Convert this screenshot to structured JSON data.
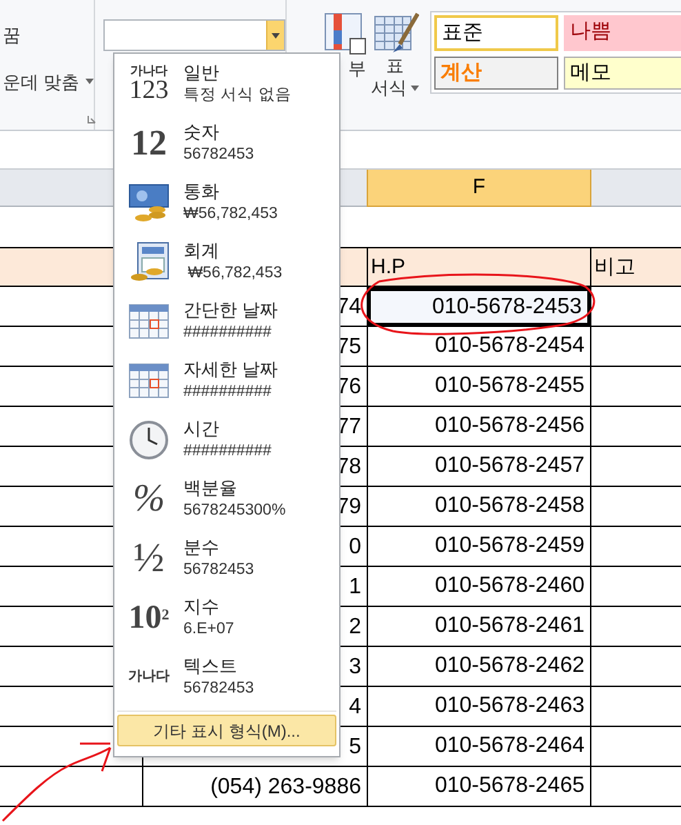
{
  "ribbon": {
    "wrap_text": "꿈",
    "merge_center": "운데 맞춤",
    "number_format": {
      "open": true
    },
    "conditional_format": "부",
    "table_format": [
      "표",
      "서식"
    ],
    "cell_styles": [
      {
        "label": "표준",
        "kind": "normal"
      },
      {
        "label": "나쁨",
        "kind": "bad"
      },
      {
        "label": "계산",
        "kind": "calculation"
      },
      {
        "label": "메모",
        "kind": "note"
      }
    ]
  },
  "format_menu": {
    "items": [
      {
        "name": "일반",
        "sample": "특정 서식 없음",
        "kind": "general",
        "glyphs": [
          "가나다",
          "123"
        ]
      },
      {
        "name": "숫자",
        "sample": "56782453",
        "kind": "number",
        "glyphs": [
          "12"
        ]
      },
      {
        "name": "통화",
        "sample": "₩56,782,453",
        "kind": "currency"
      },
      {
        "name": "회계",
        "sample": " ₩56,782,453",
        "kind": "accounting"
      },
      {
        "name": "간단한 날짜",
        "sample": "##########",
        "kind": "date"
      },
      {
        "name": "자세한 날짜",
        "sample": "##########",
        "kind": "date"
      },
      {
        "name": "시간",
        "sample": "##########",
        "kind": "time"
      },
      {
        "name": "백분율",
        "sample": "5678245300%",
        "kind": "percent",
        "glyphs": [
          "%"
        ]
      },
      {
        "name": "분수",
        "sample": "56782453",
        "kind": "fraction",
        "glyphs": [
          "½"
        ]
      },
      {
        "name": "지수",
        "sample": "6.E+07",
        "kind": "scientific",
        "glyphs": [
          "10",
          "2"
        ]
      },
      {
        "name": "텍스트",
        "sample": "56782453",
        "kind": "text",
        "glyphs": [
          "가나다"
        ]
      }
    ],
    "more_button": "기타 표시 형식(M)..."
  },
  "sheet": {
    "column_header": {
      "label": "F",
      "selected": true
    },
    "header_row": [
      "H.P",
      "비고"
    ],
    "rows": [
      {
        "column_e": "74",
        "column_f": "010-5678-2453",
        "selected": true
      },
      {
        "column_e": "75",
        "column_f": "010-5678-2454",
        "selected": false
      },
      {
        "column_e": "76",
        "column_f": "010-5678-2455",
        "selected": false
      },
      {
        "column_e": "77",
        "column_f": "010-5678-2456",
        "selected": false
      },
      {
        "column_e": "78",
        "column_f": "010-5678-2457",
        "selected": false
      },
      {
        "column_e": "79",
        "column_f": "010-5678-2458",
        "selected": false
      },
      {
        "column_e": "0",
        "column_f": "010-5678-2459",
        "selected": false
      },
      {
        "column_e": "1",
        "column_f": "010-5678-2460",
        "selected": false
      },
      {
        "column_e": "2",
        "column_f": "010-5678-2461",
        "selected": false
      },
      {
        "column_e": "3",
        "column_f": "010-5678-2462",
        "selected": false
      },
      {
        "column_e": "4",
        "column_f": "010-5678-2463",
        "selected": false
      },
      {
        "column_e": "5",
        "column_f": "010-5678-2464",
        "selected": false
      },
      {
        "column_e": "(054) 263-9886",
        "column_f": "010-5678-2465",
        "selected": false
      }
    ]
  }
}
